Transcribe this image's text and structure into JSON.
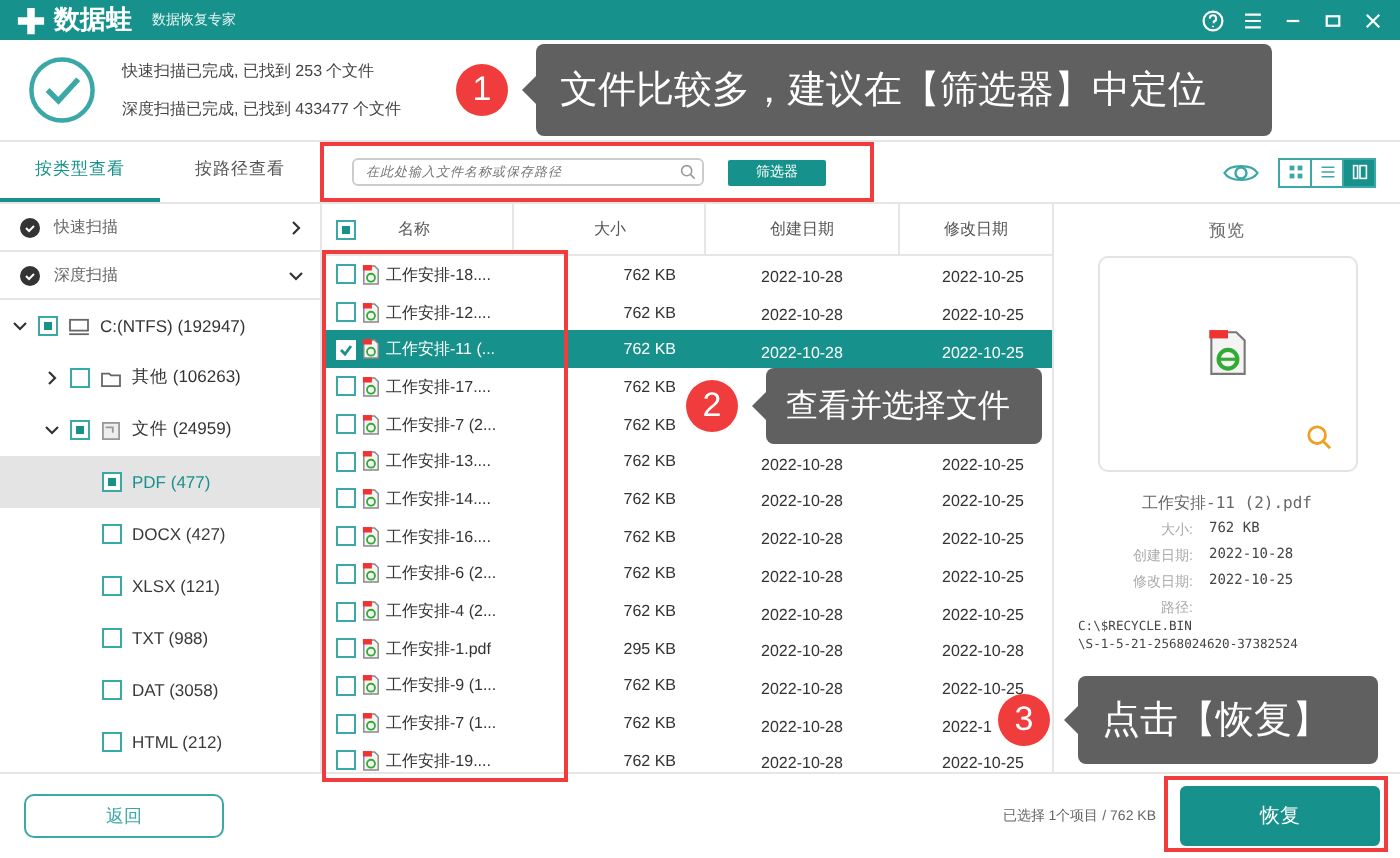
{
  "app": {
    "name": "数据蛙",
    "subtitle": "数据恢复专家"
  },
  "scan_summary": [
    "快速扫描已完成, 已找到 253 个文件",
    "深度扫描已完成, 已找到 433477 个文件"
  ],
  "tabs": [
    {
      "label": "按类型查看",
      "selected": true
    },
    {
      "label": "按路径查看",
      "selected": false
    }
  ],
  "search": {
    "placeholder": "在此处输入文件名称或保存路径"
  },
  "filter_button": "筛选器",
  "view_modes": [
    {
      "selected": false
    },
    {
      "selected": false
    },
    {
      "selected": true
    }
  ],
  "sidebar": {
    "sections": [
      {
        "label": "快速扫描",
        "expanded": false
      },
      {
        "label": "深度扫描",
        "expanded": true
      }
    ],
    "tree": [
      {
        "label": "C:(NTFS) (192947)",
        "kind": "drive",
        "checked": true,
        "expanded": true,
        "selected": false,
        "children": [
          {
            "label": "其他 (106263)",
            "kind": "folder",
            "checked": false,
            "expanded": false,
            "selected": false
          },
          {
            "label": "文件 (24959)",
            "kind": "category",
            "checked": true,
            "expanded": true,
            "selected": false,
            "children": [
              {
                "label": "PDF (477)",
                "kind": "type",
                "checked": true,
                "selected": true
              },
              {
                "label": "DOCX (427)",
                "kind": "type",
                "checked": false,
                "selected": false
              },
              {
                "label": "XLSX (121)",
                "kind": "type",
                "checked": false,
                "selected": false
              },
              {
                "label": "TXT (988)",
                "kind": "type",
                "checked": false,
                "selected": false
              },
              {
                "label": "DAT (3058)",
                "kind": "type",
                "checked": false,
                "selected": false
              },
              {
                "label": "HTML (212)",
                "kind": "type",
                "checked": false,
                "selected": false
              }
            ]
          }
        ]
      }
    ]
  },
  "table": {
    "select_all": {
      "checked": true
    },
    "columns": [
      "名称",
      "大小",
      "创建日期",
      "修改日期"
    ],
    "rows": [
      {
        "name": "工作安排-18....",
        "size": "762 KB",
        "created": "2022-10-28",
        "modified": "2022-10-25",
        "checked": false,
        "selected": false
      },
      {
        "name": "工作安排-12....",
        "size": "762 KB",
        "created": "2022-10-28",
        "modified": "2022-10-25",
        "checked": false,
        "selected": false
      },
      {
        "name": "工作安排-11 (...",
        "size": "762 KB",
        "created": "2022-10-28",
        "modified": "2022-10-25",
        "checked": true,
        "selected": true
      },
      {
        "name": "工作安排-17....",
        "size": "762 KB",
        "checked": false,
        "selected": false
      },
      {
        "name": "工作安排-7 (2...",
        "size": "762 KB",
        "checked": false,
        "selected": false
      },
      {
        "name": "工作安排-13....",
        "size": "762 KB",
        "created": "2022-10-28",
        "modified": "2022-10-25",
        "checked": false,
        "selected": false
      },
      {
        "name": "工作安排-14....",
        "size": "762 KB",
        "created": "2022-10-28",
        "modified": "2022-10-25",
        "checked": false,
        "selected": false
      },
      {
        "name": "工作安排-16....",
        "size": "762 KB",
        "created": "2022-10-28",
        "modified": "2022-10-25",
        "checked": false,
        "selected": false
      },
      {
        "name": "工作安排-6 (2...",
        "size": "762 KB",
        "created": "2022-10-28",
        "modified": "2022-10-25",
        "checked": false,
        "selected": false
      },
      {
        "name": "工作安排-4 (2...",
        "size": "762 KB",
        "created": "2022-10-28",
        "modified": "2022-10-25",
        "checked": false,
        "selected": false
      },
      {
        "name": "工作安排-1.pdf",
        "size": "295 KB",
        "created": "2022-10-28",
        "modified": "2022-10-28",
        "checked": false,
        "selected": false
      },
      {
        "name": "工作安排-9 (1...",
        "size": "762 KB",
        "created": "2022-10-28",
        "modified": "2022-10-25",
        "checked": false,
        "selected": false
      },
      {
        "name": "工作安排-7 (1...",
        "size": "762 KB",
        "created": "2022-10-28",
        "modified": "2022-1",
        "checked": false,
        "selected": false
      },
      {
        "name": "工作安排-19....",
        "size": "762 KB",
        "created": "2022-10-28",
        "modified": "2022-10-25",
        "checked": false,
        "selected": false
      }
    ]
  },
  "preview": {
    "title": "预览",
    "file_name": "工作安排-11 (2).pdf",
    "details": [
      {
        "label": "大小:",
        "value": "762 KB"
      },
      {
        "label": "创建日期:",
        "value": "2022-10-28"
      },
      {
        "label": "修改日期:",
        "value": "2022-10-25"
      }
    ],
    "path_label": "路径:",
    "path_lines": [
      "C:\\$RECYCLE.BIN",
      "\\S-1-5-21-2568024620-37382524"
    ]
  },
  "footer": {
    "back_button": "返回",
    "selection": "已选择 1个项目 / 762 KB",
    "recover_button": "恢复"
  },
  "annotations": [
    {
      "number": "1",
      "text": "文件比较多，建议在【筛选器】中定位"
    },
    {
      "number": "2",
      "text": "查看并选择文件"
    },
    {
      "number": "3",
      "text": "点击【恢复】"
    }
  ]
}
